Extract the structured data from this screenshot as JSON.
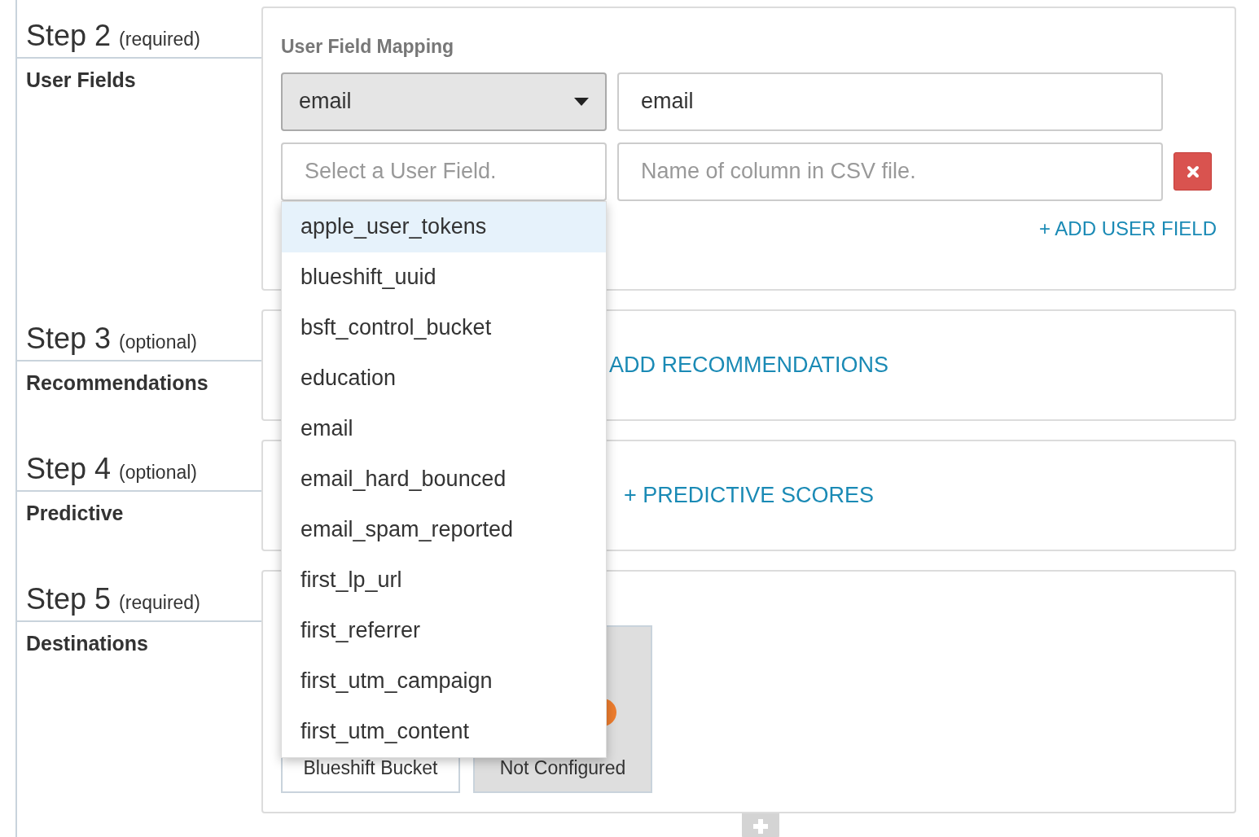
{
  "steps": [
    {
      "kind": "mapping",
      "number": "Step 2",
      "note": "(required)",
      "title": "User Fields",
      "section_title": "User Field Mapping",
      "rows": [
        {
          "field": {
            "value": "email"
          },
          "column": {
            "value": "email"
          },
          "removable": false,
          "open": false
        },
        {
          "field": {
            "placeholder": "Select a User Field."
          },
          "column": {
            "placeholder": "Name of column in CSV file."
          },
          "removable": true,
          "open": true,
          "options": [
            {
              "label": "apple_user_tokens",
              "selected": true
            },
            {
              "label": "blueshift_uuid",
              "selected": false
            },
            {
              "label": "bsft_control_bucket",
              "selected": false
            },
            {
              "label": "education",
              "selected": false
            },
            {
              "label": "email",
              "selected": false
            },
            {
              "label": "email_hard_bounced",
              "selected": false
            },
            {
              "label": "email_spam_reported",
              "selected": false
            },
            {
              "label": "first_lp_url",
              "selected": false
            },
            {
              "label": "first_referrer",
              "selected": false
            },
            {
              "label": "first_utm_campaign",
              "selected": false
            },
            {
              "label": "first_utm_content",
              "selected": false
            }
          ]
        }
      ],
      "add_link": "+ ADD USER FIELD"
    },
    {
      "kind": "link",
      "number": "Step 3",
      "note": "(optional)",
      "title": "Recommendations",
      "link": "ADD RECOMMENDATIONS"
    },
    {
      "kind": "link",
      "number": "Step 4",
      "note": "(optional)",
      "title": "Predictive",
      "link": "+ PREDICTIVE SCORES"
    },
    {
      "kind": "destinations",
      "number": "Step 5",
      "note": "(required)",
      "title": "Destinations",
      "cards": [
        {
          "label": "Blueshift Bucket",
          "configured": true
        },
        {
          "label": "Not Configured",
          "configured": false
        }
      ]
    }
  ]
}
